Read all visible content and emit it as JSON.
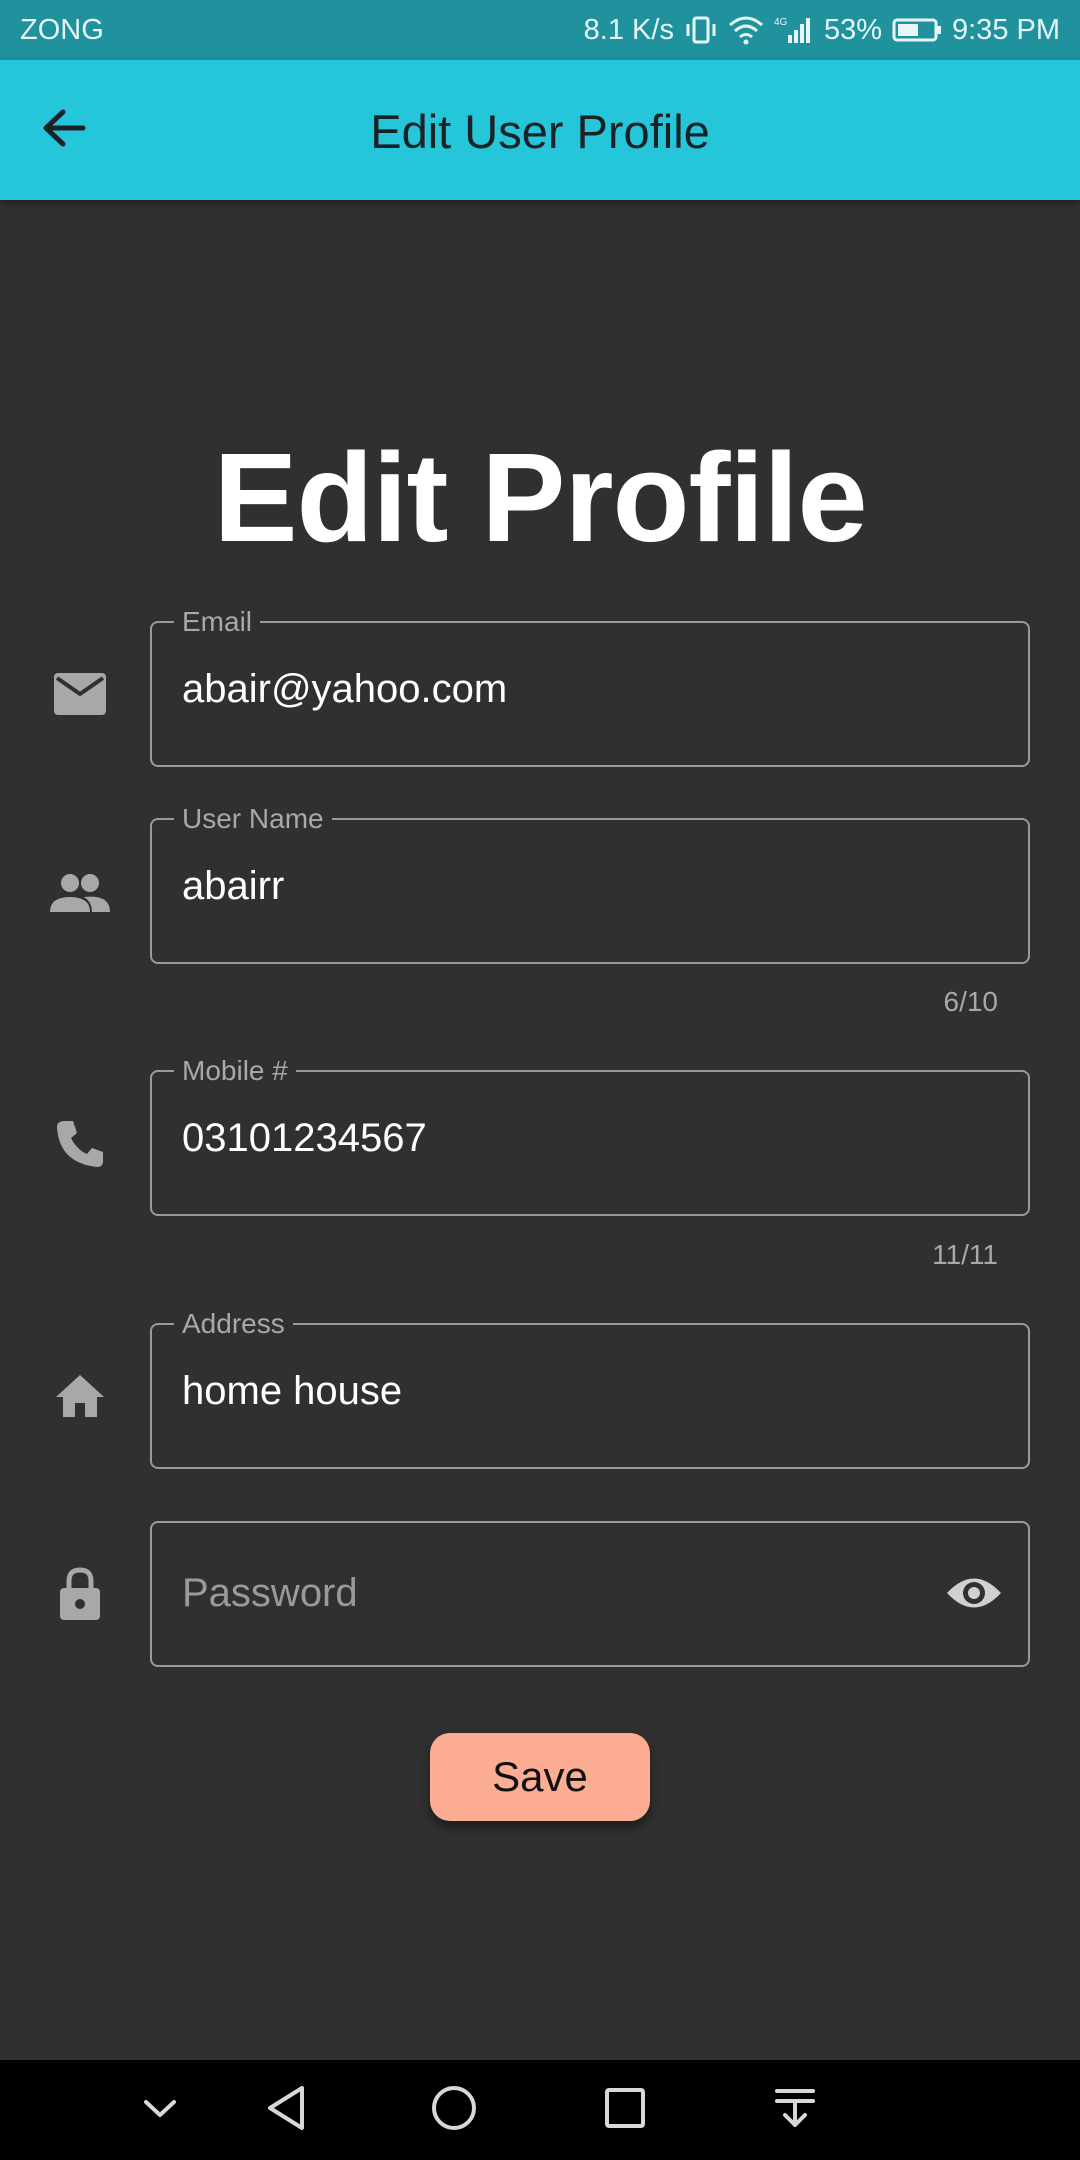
{
  "status_bar": {
    "carrier": "ZONG",
    "speed": "8.1 K/s",
    "battery": "53%",
    "time": "9:35 PM",
    "network": "4G",
    "icons": [
      "vibrate-icon",
      "wifi-icon",
      "signal-icon",
      "battery-icon"
    ]
  },
  "app_bar": {
    "title": "Edit User Profile",
    "back_icon": "arrow-back-icon",
    "background": "#26c6da"
  },
  "page": {
    "title": "Edit Profile"
  },
  "form": {
    "email": {
      "label": "Email",
      "value": "abair@yahoo.com",
      "icon": "mail-icon"
    },
    "username": {
      "label": "User Name",
      "value": "abairr",
      "counter": "6/10",
      "icon": "people-icon"
    },
    "mobile": {
      "label": "Mobile #",
      "value": "03101234567",
      "counter": "11/11",
      "icon": "phone-icon"
    },
    "address": {
      "label": "Address",
      "value": "home house",
      "icon": "home-icon"
    },
    "password": {
      "placeholder": "Password",
      "icon": "lock-icon",
      "toggle_icon": "eye-icon"
    }
  },
  "save_button": {
    "label": "Save",
    "color": "#fcad93"
  },
  "nav_bar": {
    "icons": [
      "chevron-down-icon",
      "back-triangle-icon",
      "home-circle-icon",
      "recents-square-icon",
      "notification-pull-icon"
    ]
  },
  "colors": {
    "background": "#303030",
    "field_border": "#9a9a9a",
    "status_bar": "#1f929e"
  }
}
